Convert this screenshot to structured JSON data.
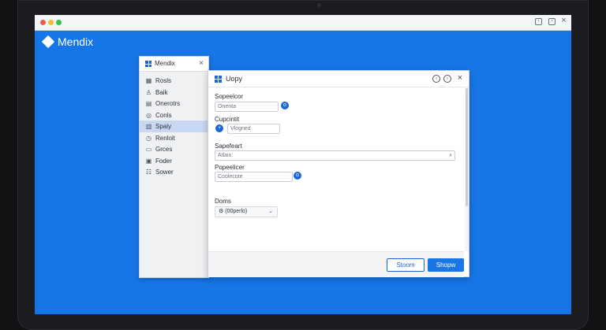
{
  "brand": {
    "name": "Mendix"
  },
  "nav": {
    "title": "Mendix",
    "items": [
      {
        "label": "Rosls",
        "icon": "grid-icon"
      },
      {
        "label": "Baik",
        "icon": "user-icon"
      },
      {
        "label": "Onerotrs",
        "icon": "table-icon"
      },
      {
        "label": "Conls",
        "icon": "circle-icon"
      },
      {
        "label": "Spaly",
        "icon": "layout-icon",
        "active": true
      },
      {
        "label": "Renloit",
        "icon": "clock-icon"
      },
      {
        "label": "Grces",
        "icon": "list-icon"
      },
      {
        "label": "Foder",
        "icon": "folder-icon"
      },
      {
        "label": "Sower",
        "icon": "sliders-icon"
      }
    ]
  },
  "dialog": {
    "title": "Uopy",
    "field1": {
      "label": "Sopeelcor",
      "value": "Onenta"
    },
    "field2": {
      "label": "Cupcintit",
      "value": "Vlogned"
    },
    "field3": {
      "label": "Sapefeart",
      "value": "Atlaix"
    },
    "field4": {
      "label": "Popeelicer",
      "value": "Coolecote"
    },
    "dropdown": {
      "label": "Doms",
      "value": "(00perlo)"
    },
    "buttons": {
      "secondary": "Stoom",
      "primary": "Shopw"
    }
  }
}
